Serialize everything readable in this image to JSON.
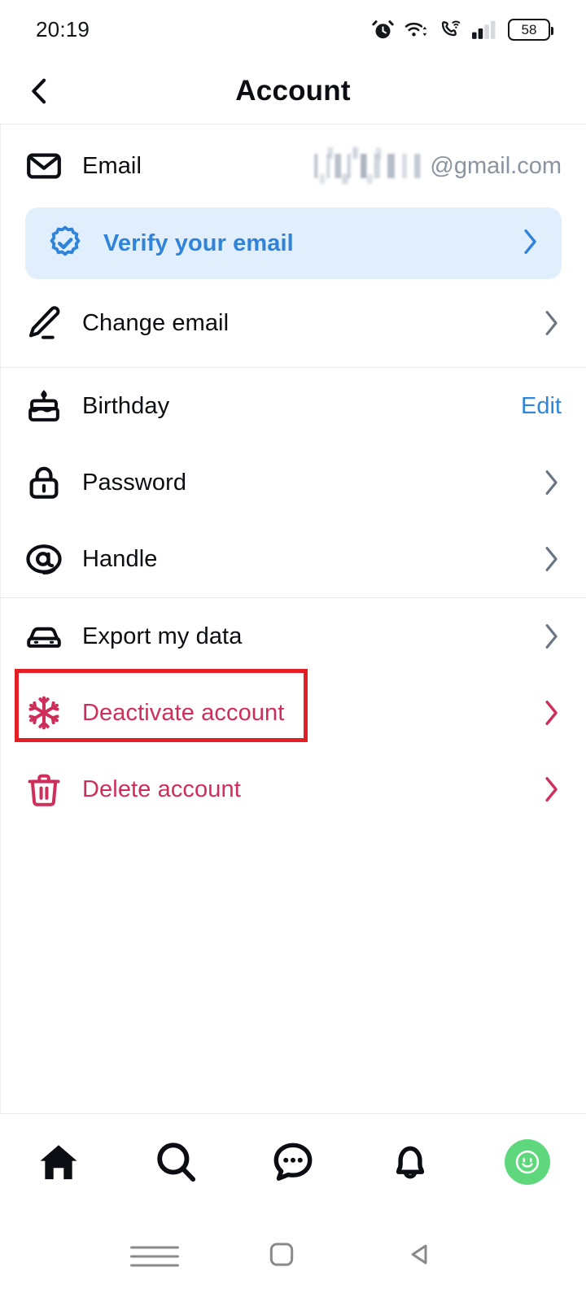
{
  "statusbar": {
    "time": "20:19",
    "battery_level": "58",
    "icons": [
      "alarm-clock-icon",
      "wifi-icon",
      "vowifi-call-icon",
      "cellular-signal-icon",
      "battery-icon"
    ]
  },
  "header": {
    "title": "Account",
    "back_icon": "chevron-left-icon"
  },
  "sections": [
    {
      "rows": [
        {
          "name": "email",
          "icon": "envelope-icon",
          "label": "Email",
          "value_suffix": "@gmail.com",
          "value_redacted": true,
          "trailing": "value"
        },
        {
          "name": "verify-email",
          "icon": "verified-badge-icon",
          "label": "Verify your email",
          "trailing": "chevron",
          "style": "banner"
        },
        {
          "name": "change-email",
          "icon": "pencil-icon",
          "label": "Change email",
          "trailing": "chevron"
        }
      ]
    },
    {
      "rows": [
        {
          "name": "birthday",
          "icon": "birthday-cake-icon",
          "label": "Birthday",
          "trailing": "link",
          "link_label": "Edit"
        },
        {
          "name": "password",
          "icon": "lock-icon",
          "label": "Password",
          "trailing": "chevron"
        },
        {
          "name": "handle",
          "icon": "at-sign-icon",
          "label": "Handle",
          "trailing": "chevron"
        }
      ]
    },
    {
      "rows": [
        {
          "name": "export-my-data",
          "icon": "car-icon",
          "label": "Export my data",
          "trailing": "chevron",
          "highlighted": true
        },
        {
          "name": "deactivate-account",
          "icon": "snowflake-icon",
          "label": "Deactivate account",
          "trailing": "chevron",
          "danger": true
        },
        {
          "name": "delete-account",
          "icon": "trash-icon",
          "label": "Delete account",
          "trailing": "chevron",
          "danger": true
        }
      ]
    }
  ],
  "tabbar": {
    "items": [
      {
        "name": "home-tab",
        "icon": "home-icon",
        "active": true
      },
      {
        "name": "search-tab",
        "icon": "search-icon",
        "active": false
      },
      {
        "name": "chat-tab",
        "icon": "chat-bubble-icon",
        "active": false
      },
      {
        "name": "notifications-tab",
        "icon": "bell-icon",
        "active": false
      },
      {
        "name": "profile-tab",
        "icon": "avatar-smiley-icon",
        "active": false
      }
    ]
  },
  "androidnav": {
    "items": [
      {
        "name": "recents-button",
        "icon": "menu-lines-icon"
      },
      {
        "name": "home-button",
        "icon": "rounded-square-icon"
      },
      {
        "name": "back-button",
        "icon": "triangle-left-icon"
      }
    ]
  },
  "colors": {
    "accent_blue": "#2f83d8",
    "banner_bg": "#e1effc",
    "danger_red": "#cf2e5b",
    "annotation_red": "#e31e24",
    "chevron_gray": "#6b7682",
    "value_gray": "#8a94a0",
    "avatar_green": "#5fd77d"
  }
}
